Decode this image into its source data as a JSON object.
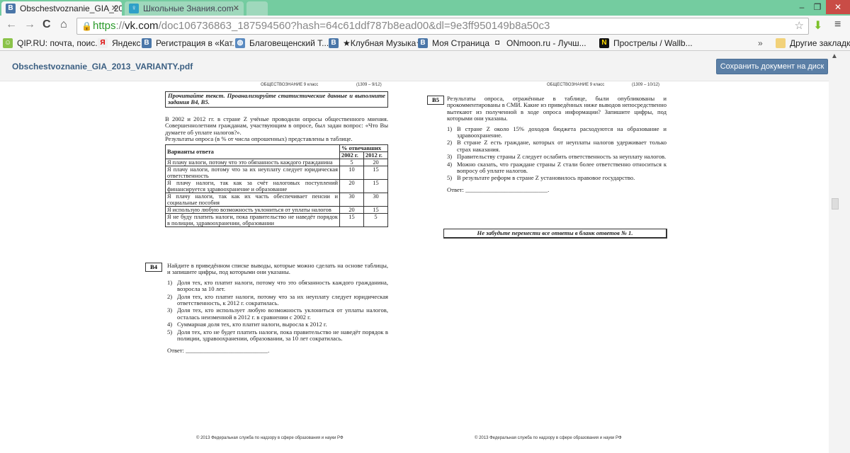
{
  "browser": {
    "tabs": [
      {
        "title": "Obschestvoznanie_GIA_20",
        "favicon": "vk-icon"
      },
      {
        "title": "Школьные Знания.com -",
        "favicon": "znanija-icon"
      }
    ],
    "url": {
      "scheme": "https",
      "sep": "://",
      "host": "vk.com",
      "path": "/doc106736863_187594560?hash=64c61ddf787b8ead00&dl=9e3ff950149b8a50c3"
    },
    "bookmarks": [
      {
        "label": "QIP.RU: почта, поис...",
        "icon": "qip-icon"
      },
      {
        "label": "Яндекс",
        "icon": "yandex-icon"
      },
      {
        "label": "Регистрация в «Кат...",
        "icon": "vk-icon"
      },
      {
        "label": "Благовещенский Т...",
        "icon": "globe-icon"
      },
      {
        "label": "★Клубная Музыка★",
        "icon": "vk-icon"
      },
      {
        "label": "Моя Страница",
        "icon": "vk-icon"
      },
      {
        "label": "ONmoon.ru - Лучш...",
        "icon": "onmoon-icon"
      },
      {
        "label": "Прострелы / Wallb...",
        "icon": "n-icon"
      }
    ],
    "overflow": "»",
    "other_bookmarks": "Другие закладки",
    "colors": {
      "tabbar": "#74cca0",
      "button": "#5b7fa6"
    }
  },
  "doc": {
    "title": "Obschestvoznanie_GIA_2013_VARIANTY.pdf",
    "save_label": "Сохранить документ на диск"
  },
  "left_page": {
    "header_subject": "ОБЩЕСТВОЗНАНИЕ  9 класс",
    "header_code": "(1309 – 9/12)",
    "instruction": "Прочитайте текст. Проанализируйте статистические данные и выполните задания B4, B5.",
    "intro": "В 2002 и 2012 гг. в стране Z учёные проводили опросы общественного мнения. Совершеннолетним гражданам, участвующим в опросе, был задан вопрос: «Что Вы думаете об уплате налогов?».",
    "intro2": "Результаты опроса (в % от числа опрошенных) представлены в таблице.",
    "table": {
      "col_answer": "Варианты ответа",
      "col_percent": "% отвечавших",
      "col_2002": "2002 г.",
      "col_2012": "2012 г.",
      "rows": [
        {
          "text": "Я плачу налоги, потому что это обязанность каждого гражданина",
          "v2002": "5",
          "v2012": "20"
        },
        {
          "text": "Я плачу налоги, потому что за их неуплату следует юридическая ответственность",
          "v2002": "10",
          "v2012": "15"
        },
        {
          "text": "Я плачу налоги, так как за счёт налоговых поступлений финансируется здравоохранение и образование",
          "v2002": "20",
          "v2012": "15"
        },
        {
          "text": "Я плачу налоги, так как их часть обеспечивает пенсии и социальные пособия",
          "v2002": "30",
          "v2012": "30"
        },
        {
          "text": "Я использую любую возможность уклониться от уплаты налогов",
          "v2002": "20",
          "v2012": "15"
        },
        {
          "text": "Я не буду платить налоги, пока правительство не наведёт порядок в полиции, здравоохранении, образовании",
          "v2002": "15",
          "v2012": "5"
        }
      ]
    },
    "b4": {
      "tag": "B4",
      "question": "Найдите в приведённом списке выводы, которые можно сделать на основе таблицы, и запишите цифры, под которыми они указаны.",
      "options": [
        {
          "n": "1)",
          "text": "Доля тех, кто платит налоги, потому что это обязанность каждого гражданина, возросла за 10 лет."
        },
        {
          "n": "2)",
          "text": "Доля тех, кто платит налоги, потому что за их неуплату следует юридическая ответственность, к 2012 г. сократилась."
        },
        {
          "n": "3)",
          "text": "Доля тех, кто использует любую возможность уклониться от уплаты налогов, осталась неизменной в 2012 г. в сравнении с 2002 г."
        },
        {
          "n": "4)",
          "text": "Суммарная доля тех, кто платит налоги, выросла к 2012 г."
        },
        {
          "n": "5)",
          "text": "Доля тех, кто не будет платить налоги, пока правительство не наведёт порядок в полиции, здравоохранении, образовании, за 10 лет сократилась."
        }
      ],
      "answer": "Ответ: ___________________________."
    },
    "footer": "© 2013 Федеральная служба по надзору в сфере образования и науки РФ"
  },
  "right_page": {
    "header_subject": "ОБЩЕСТВОЗНАНИЕ  9 класс",
    "header_code": "(1309 – 10/12)",
    "b5": {
      "tag": "B5",
      "question": "Результаты опроса, отражённые в таблице, были опубликованы и прокомментированы в СМИ. Какие из приведённых ниже выводов непосредственно вытекают из полученной в ходе опроса информации? Запишите цифры, под которыми они указаны.",
      "options": [
        {
          "n": "1)",
          "text": "В стране Z около 15% доходов бюджета расходуются на образование и здравоохранение."
        },
        {
          "n": "2)",
          "text": "В стране Z есть граждане, которых от неуплаты налогов удерживает только страх наказания."
        },
        {
          "n": "3)",
          "text": "Правительству страны Z следует ослабить ответственность за неуплату налогов."
        },
        {
          "n": "4)",
          "text": "Можно сказать, что граждане страны Z стали более ответственно относиться к вопросу об уплате налогов."
        },
        {
          "n": "5)",
          "text": "В результате реформ в стране Z установилось правовое государство."
        }
      ],
      "answer": "Ответ: ___________________________."
    },
    "reminder": "Не забудьте перенести все ответы в бланк ответов № 1.",
    "footer": "© 2013 Федеральная служба по надзору в сфере образования и науки РФ"
  }
}
